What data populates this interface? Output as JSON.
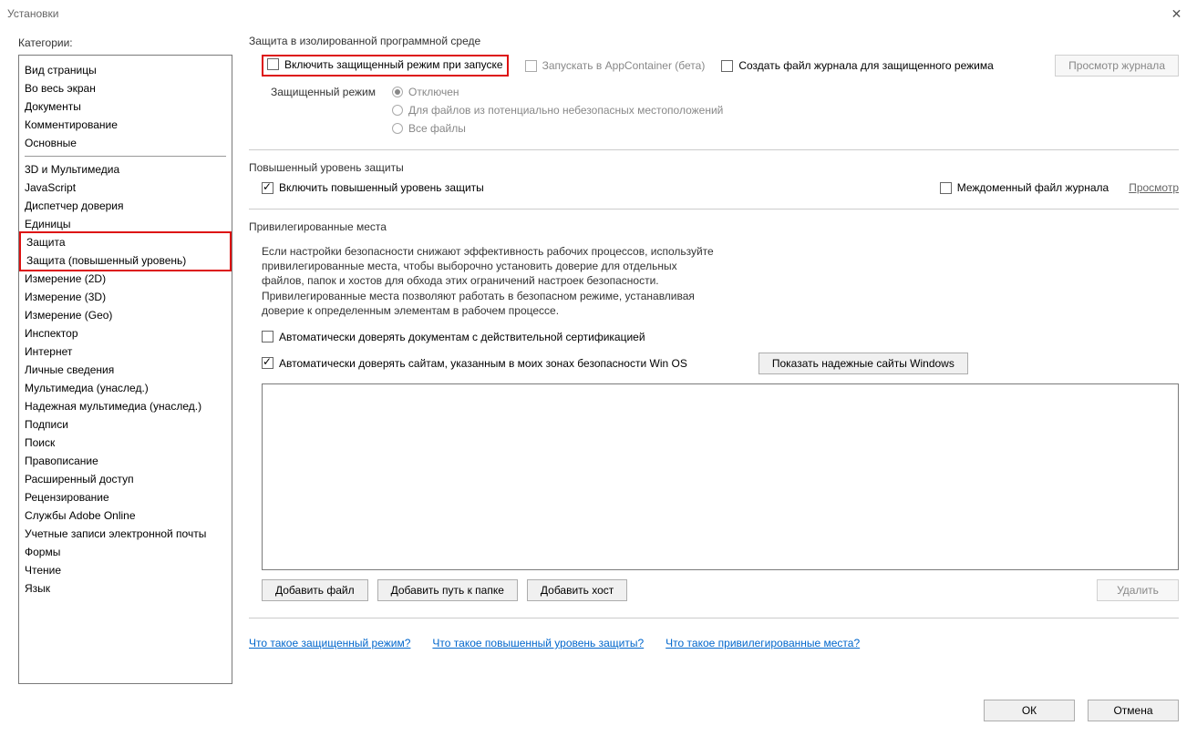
{
  "window": {
    "title": "Установки"
  },
  "sidebar": {
    "title": "Категории:",
    "group1": [
      "Вид страницы",
      "Во весь экран",
      "Документы",
      "Комментирование",
      "Основные"
    ],
    "group2": [
      "3D и Мультимедиа",
      "JavaScript",
      "Диспетчер доверия",
      "Единицы",
      "Защита",
      "Защита (повышенный уровень)",
      "Измерение (2D)",
      "Измерение (3D)",
      "Измерение (Geo)",
      "Инспектор",
      "Интернет",
      "Личные сведения",
      "Мультимедиа (унаслед.)",
      "Надежная мультимедиа (унаслед.)",
      "Подписи",
      "Поиск",
      "Правописание",
      "Расширенный доступ",
      "Рецензирование",
      "Службы Adobe Online",
      "Учетные записи электронной почты",
      "Формы",
      "Чтение",
      "Язык"
    ]
  },
  "section_sandbox": {
    "title": "Защита в изолированной программной среде",
    "enable_protected": "Включить защищенный режим при запуске",
    "appcontainer": "Запускать в AppContainer (бета)",
    "create_log": "Создать файл журнала для защищенного режима",
    "view_log_btn": "Просмотр журнала",
    "mode_label": "Защищенный режим",
    "radio_off": "Отключен",
    "radio_unsafe": "Для файлов из потенциально небезопасных местоположений",
    "radio_all": "Все файлы"
  },
  "section_enhanced": {
    "title": "Повышенный уровень защиты",
    "enable": "Включить повышенный уровень защиты",
    "crossdomain_log": "Междоменный файл журнала",
    "view": "Просмотр"
  },
  "section_priv": {
    "title": "Привилегированные места",
    "desc": "Если настройки безопасности снижают эффективность рабочих процессов, используйте привилегированные места, чтобы выборочно установить доверие для отдельных файлов, папок и хостов для обхода этих ограничений настроек безопасности. Привилегированные места позволяют работать в безопасном режиме, устанавливая доверие к определенным элементам в рабочем процессе.",
    "trust_cert": "Автоматически доверять документам с действительной сертификацией",
    "trust_winos": "Автоматически доверять сайтам, указанным в моих зонах безопасности Win OS",
    "show_trusted_btn": "Показать надежные сайты Windows",
    "add_file": "Добавить файл",
    "add_folder": "Добавить путь к папке",
    "add_host": "Добавить хост",
    "delete": "Удалить"
  },
  "help_links": {
    "protected": "Что такое защищенный режим?",
    "enhanced": "Что такое повышенный уровень защиты?",
    "priv": "Что такое привилегированные места?"
  },
  "footer": {
    "ok": "ОК",
    "cancel": "Отмена"
  }
}
